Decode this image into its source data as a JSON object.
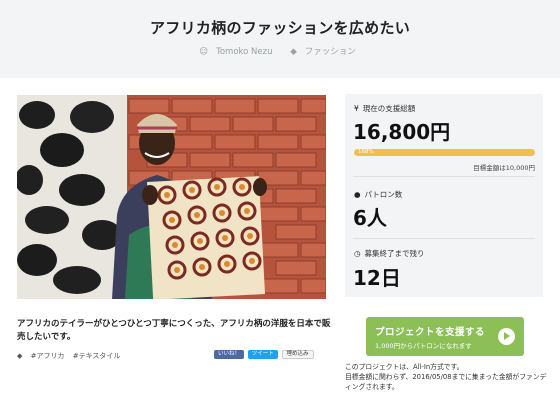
{
  "project": {
    "title": "アフリカ柄のファッションを広めたい",
    "author": "Tomoko Nezu",
    "category": "ファッション",
    "description": "アフリカのテイラーがひとつひとつ丁寧につくった、アフリカ柄の洋服を日本で販売したいです。",
    "tags": [
      "#アフリカ",
      "#テキスタイル"
    ]
  },
  "social": {
    "like": "いいね！",
    "tweet": "ツイート",
    "embed": "埋め込み"
  },
  "stats": {
    "support_label": "現在の支援総額",
    "support_value": "16,800円",
    "progress_text": "168%",
    "progress_fraction": 1.0,
    "goal_text": "目標金額は10,000円",
    "patron_label": "パトロン数",
    "patron_value": "6人",
    "remaining_label": "募集終了まで残り",
    "remaining_value": "12日"
  },
  "cta": {
    "title": "プロジェクトを支援する",
    "subtitle": "1,000円からパトロンになれます"
  },
  "allin_text": "このプロジェクトは、All-In方式です。\n目標金額に関わらず、2016/05/08までに集まった金額がファンディングされます。",
  "colors": {
    "accent": "#8cc056",
    "progress": "#f2bf4a",
    "panel": "#f2f4f6"
  },
  "icons": {
    "author": "user-icon",
    "category": "tag-icon",
    "support": "yen-icon",
    "patrons": "users-icon",
    "remaining": "clock-icon",
    "arrow": "arrow-right-circle-icon"
  }
}
